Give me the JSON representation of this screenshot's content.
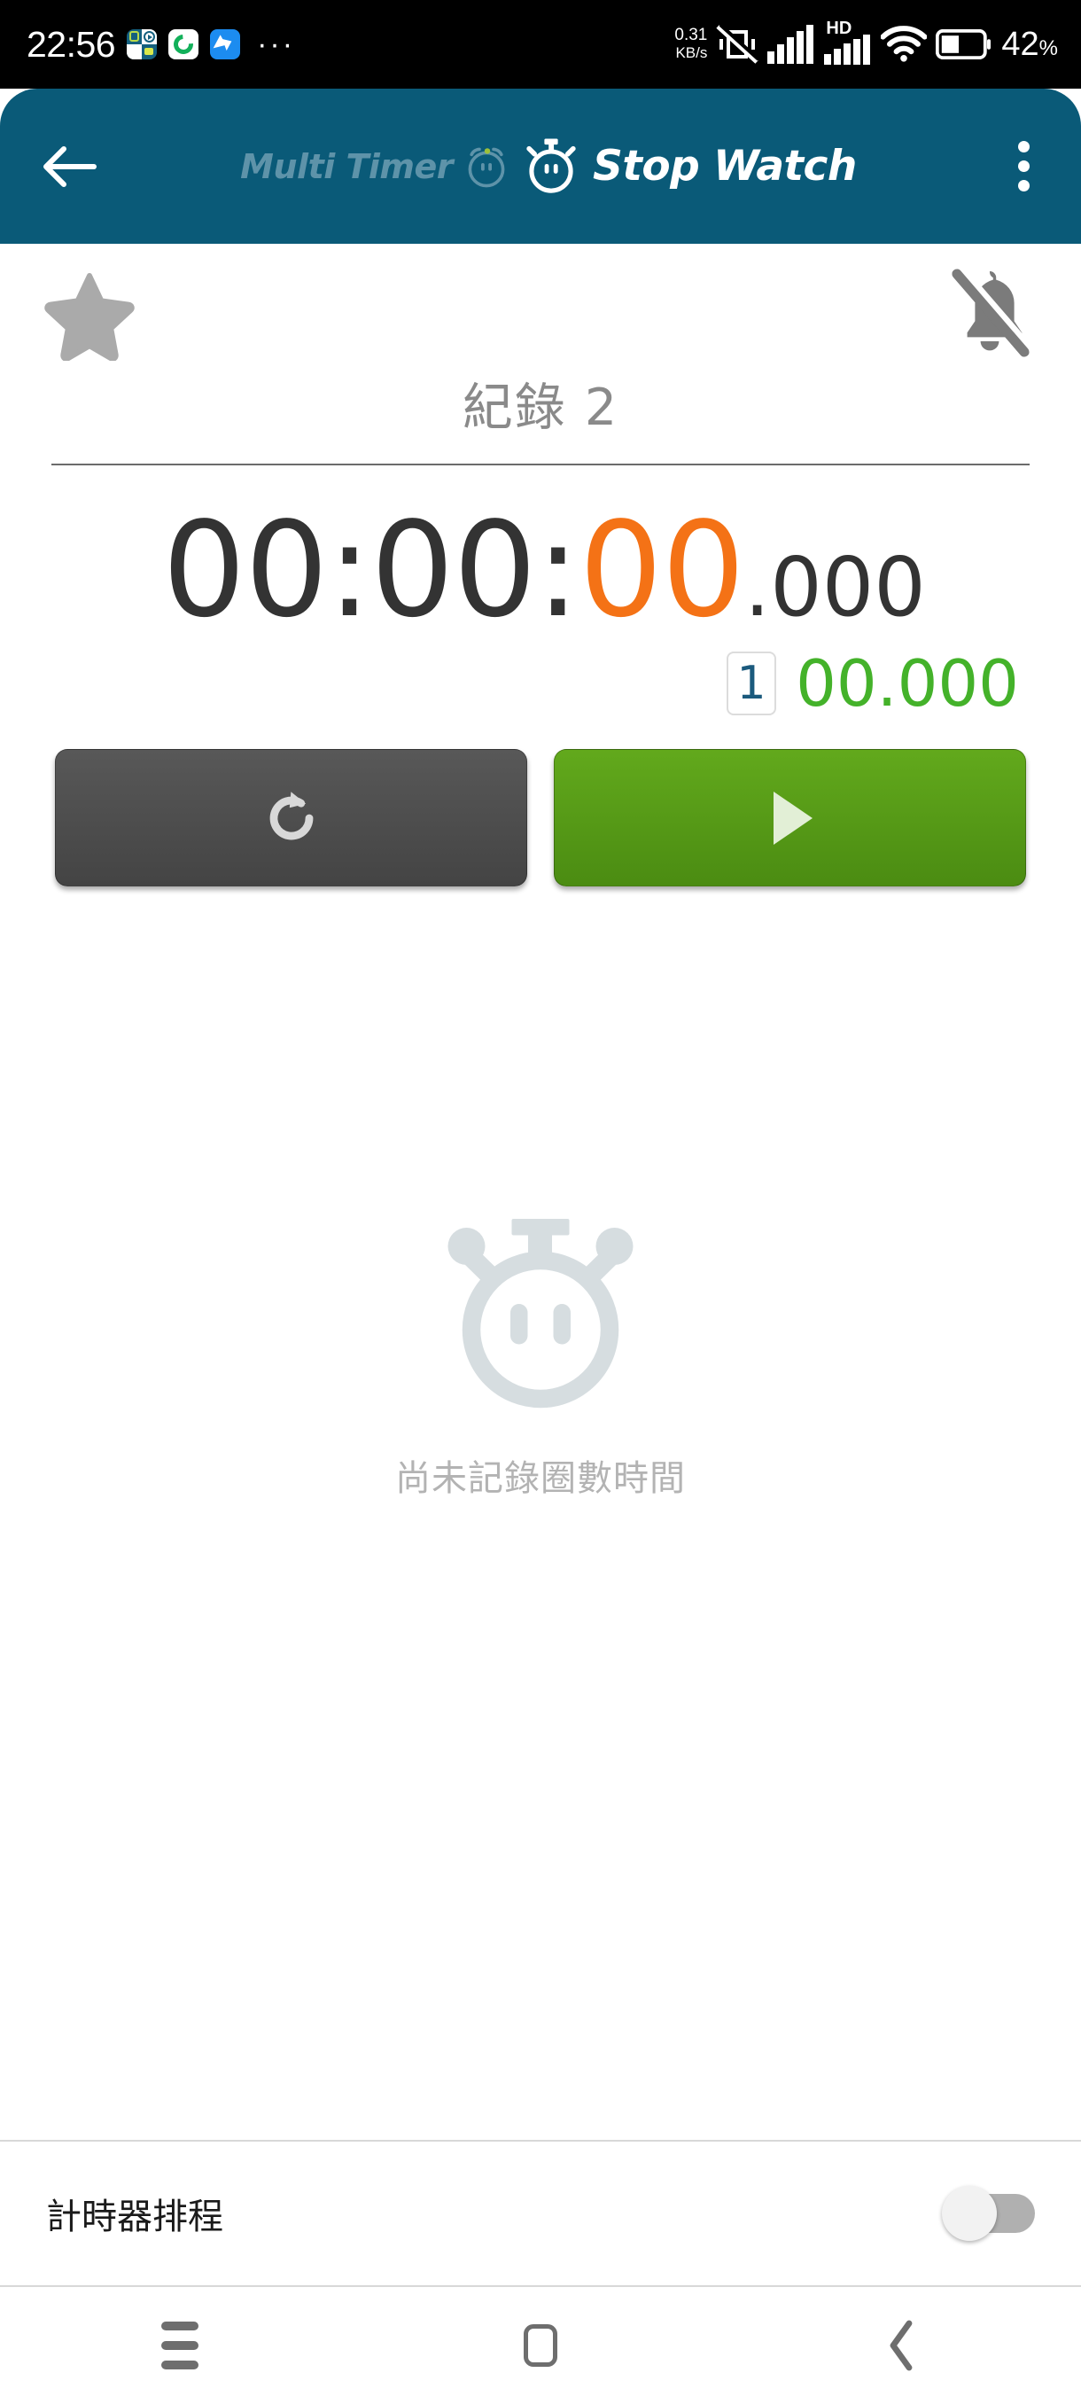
{
  "status_bar": {
    "clock": "22:56",
    "app_icons": [
      "multi-timer-icon",
      "green-sync-icon",
      "blue-bird-icon"
    ],
    "overflow": "···",
    "net_speed_value": "0.31",
    "net_speed_unit": "KB/s",
    "icons": [
      "vibrate-off-icon",
      "signal-1-icon",
      "hd-icon",
      "signal-2-icon",
      "wifi-icon",
      "battery-icon"
    ],
    "hd_label": "HD",
    "battery_percent": "42",
    "percent_sign": "%"
  },
  "app_bar": {
    "back_icon": "arrow-left-icon",
    "inactive_tab_label": "Multi Timer",
    "inactive_tab_icon": "alarm-clock-icon",
    "active_tab_label": "Stop Watch",
    "active_tab_icon": "stopwatch-icon",
    "menu_icon": "overflow-menu-icon",
    "background_color": "#0a5a78"
  },
  "main": {
    "favorite_icon": "star-icon",
    "notification_icon": "bell-off-icon",
    "timer_name": "紀錄 2",
    "time": {
      "hours": "00",
      "sep1": ":",
      "minutes": "00",
      "sep2": ":",
      "seconds": "00",
      "dot": ".",
      "milliseconds": "000",
      "seconds_color": "#f47216",
      "main_color": "#333333"
    },
    "lap": {
      "number": "1",
      "time": "00.000",
      "time_color": "#44b22a",
      "number_color": "#1b5a7d"
    },
    "buttons": {
      "reset_icon": "refresh-reset-icon",
      "reset_color": "#4e4e4e",
      "start_icon": "play-icon",
      "start_color": "#57a016"
    },
    "empty_state": {
      "icon": "stopwatch-large-icon",
      "text": "尚未記錄圈數時間"
    }
  },
  "setting_row": {
    "label": "計時器排程",
    "toggle_state": "off"
  },
  "nav_bar": {
    "recents_icon": "recents-icon",
    "home_icon": "home-icon",
    "back_icon": "back-chevron-icon"
  }
}
